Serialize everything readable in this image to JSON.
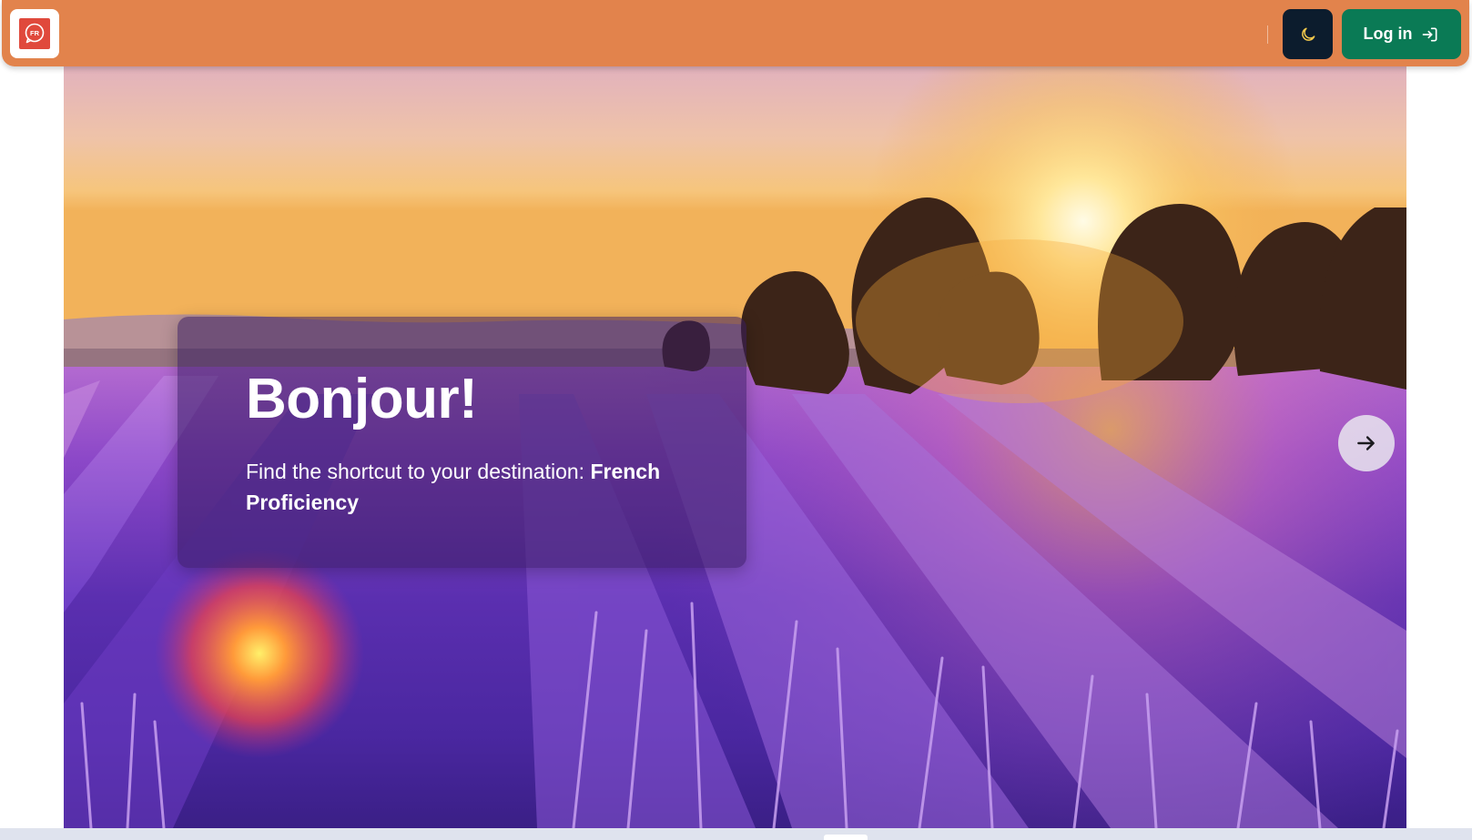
{
  "header": {
    "logo_label": "FR",
    "login_label": "Log in"
  },
  "hero": {
    "title": "Bonjour!",
    "text_prefix": "Find the shortcut to your destination: ",
    "text_highlight": "French Proficiency"
  },
  "icons": {
    "theme_toggle": "moon-icon",
    "login": "login-arrow-icon",
    "next": "arrow-right-icon"
  },
  "colors": {
    "header_bg": "#e2834c",
    "login_bg": "#0a7a55",
    "theme_btn_bg": "#0c1c2d",
    "logo_red": "#e0493c"
  }
}
